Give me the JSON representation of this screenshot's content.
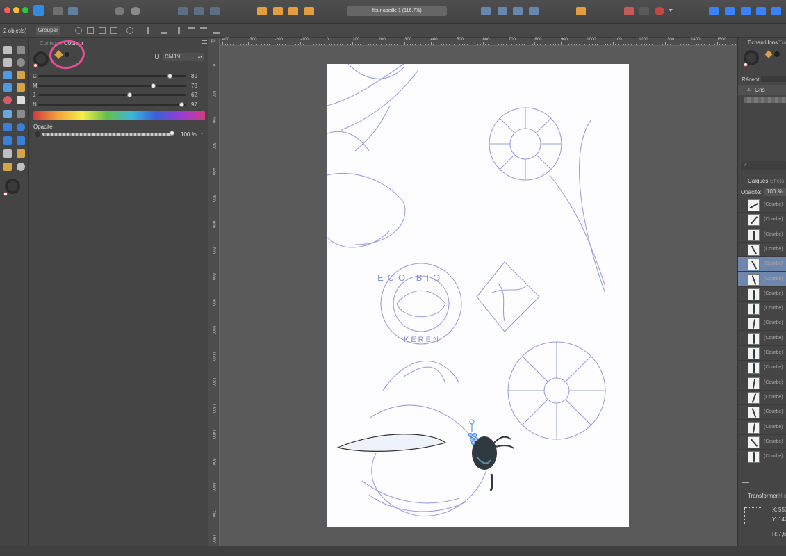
{
  "window": {
    "title": "fleur abeille 1 (116.7%)"
  },
  "context": {
    "selection_count": "2 objet(s)",
    "group_label": "Grouper"
  },
  "color_panel": {
    "tabs": [
      "Contexte",
      "Couleur"
    ],
    "model": "CMJN",
    "sliders": [
      {
        "label": "C",
        "value": "89",
        "fraction": 0.89
      },
      {
        "label": "M",
        "value": "78",
        "fraction": 0.78
      },
      {
        "label": "J",
        "value": "62",
        "fraction": 0.62
      },
      {
        "label": "N",
        "value": "97",
        "fraction": 0.97
      }
    ],
    "opacity_label": "Opacité",
    "opacity_value": "100 %",
    "opacity_fraction": 1.0,
    "annotation_color": "#e94d9c"
  },
  "ruler": {
    "unit": "px",
    "horizontal_ticks": [
      "400",
      "-300",
      "-200",
      "-100",
      "0",
      "100",
      "200",
      "300",
      "400",
      "500",
      "600",
      "700",
      "800",
      "900",
      "1000",
      "1100",
      "1200",
      "1300",
      "1400",
      "1500"
    ],
    "vertical_ticks": [
      "0",
      "100",
      "200",
      "300",
      "400",
      "500",
      "600",
      "700",
      "800",
      "900",
      "1000",
      "1100",
      "1200",
      "1300",
      "1400",
      "1500",
      "1600",
      "1700",
      "1800"
    ]
  },
  "right_panel": {
    "tabs": [
      "Échantillons",
      "Trai"
    ],
    "recent_label": "Récent:",
    "swatch_group": "Gris",
    "layer_tabs": [
      "Calques",
      "Effets"
    ],
    "opacity_label": "Opacité:",
    "opacity_value": "100 %",
    "layers": [
      {
        "name": "(Courbe)",
        "selected": false
      },
      {
        "name": "(Courbe)",
        "selected": false
      },
      {
        "name": "(Courbe)",
        "selected": false
      },
      {
        "name": "(Courbe)",
        "selected": false
      },
      {
        "name": "(Courbe)",
        "selected": true
      },
      {
        "name": "(Courbe)",
        "selected": true
      },
      {
        "name": "(Courbe)",
        "selected": false
      },
      {
        "name": "(Courbe)",
        "selected": false
      },
      {
        "name": "(Courbe)",
        "selected": false
      },
      {
        "name": "(Courbe)",
        "selected": false
      },
      {
        "name": "(Courbe)",
        "selected": false
      },
      {
        "name": "(Courbe)",
        "selected": false
      },
      {
        "name": "(Courbe)",
        "selected": false
      },
      {
        "name": "(Courbe)",
        "selected": false
      },
      {
        "name": "(Courbe)",
        "selected": false
      },
      {
        "name": "(Courbe)",
        "selected": false
      },
      {
        "name": "(Courbe)",
        "selected": false
      },
      {
        "name": "(Courbe)",
        "selected": false
      }
    ],
    "transform_tabs": [
      "Transformer",
      "Hist"
    ],
    "transform": {
      "x_label": "X:",
      "x_value": "550",
      "y_label": "Y:",
      "y_value": "142",
      "r_label": "R:",
      "r_value": "7,6"
    }
  },
  "sketch_text": {
    "line1": "ECO BIO",
    "line2": "KEREN"
  },
  "colors": {
    "accent": "#3b82f6",
    "selection": "#6f86ad",
    "sketch": "#8b8fd9",
    "bee_body": "#2f3a40"
  }
}
